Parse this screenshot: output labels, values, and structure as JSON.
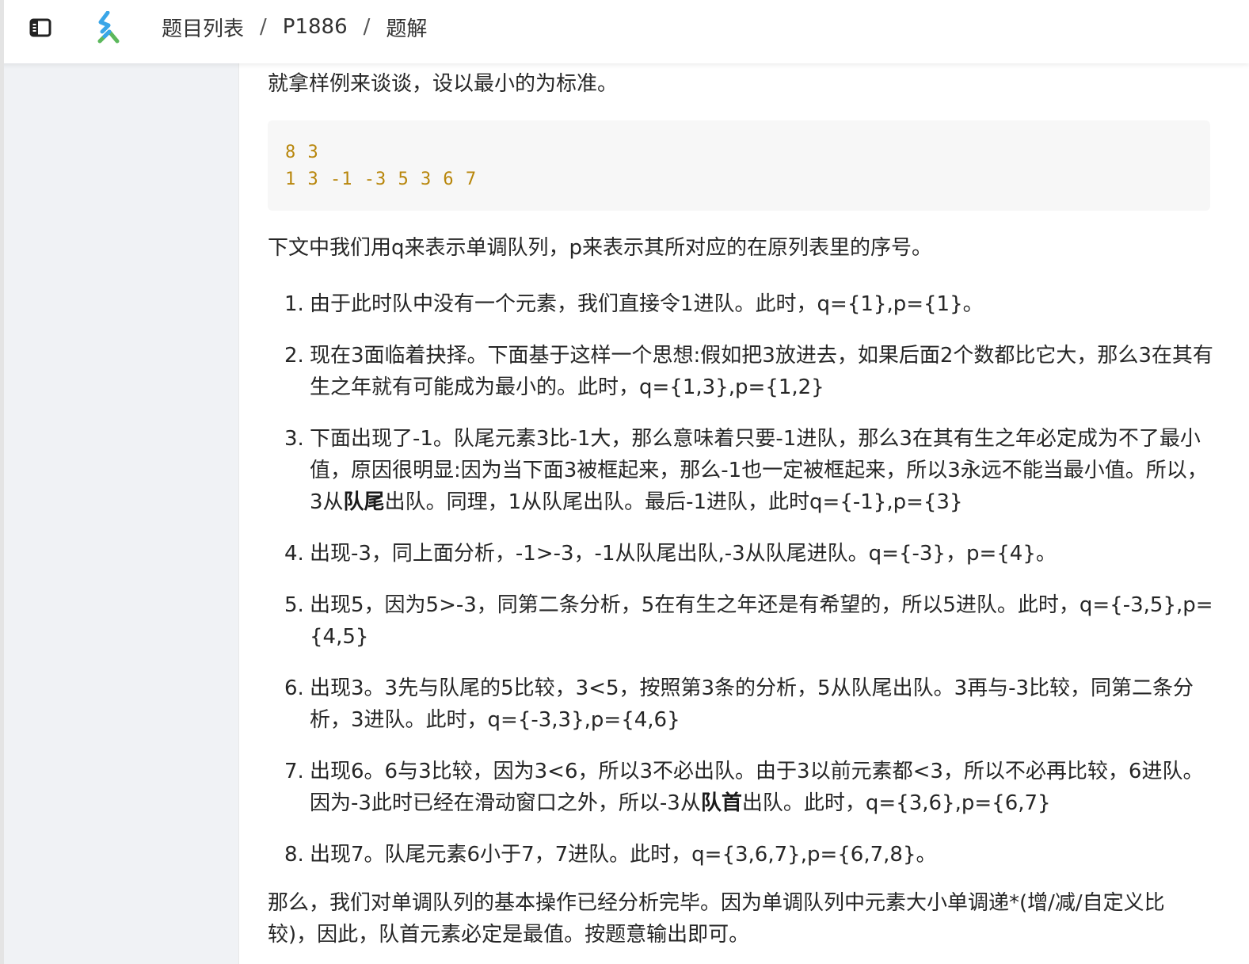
{
  "header": {
    "sidebar_toggle_icon": "sidebar-toggle-icon",
    "logo_icon": "app-logo-icon",
    "breadcrumb": [
      "题目列表",
      "P1886",
      "题解"
    ],
    "separator": "/"
  },
  "article": {
    "intro": "就拿样例来谈谈，设以最小的为标准。",
    "code_lines": [
      "8 3",
      "1 3 -1 -3 5 3 6 7"
    ],
    "explain": "下文中我们用q来表示单调队列，p来表示其所对应的在原列表里的序号。",
    "steps": [
      {
        "num": "1.",
        "parts": [
          "由于此时队中没有一个元素，我们直接令1进队。此时，q={1},p={1}。"
        ]
      },
      {
        "num": "2.",
        "parts": [
          "现在3面临着抉择。下面基于这样一个思想:假如把3放进去，如果后面2个数都比它大，那么3在其有生之年就有可能成为最小的。此时，q={1,3},p={1,2}"
        ]
      },
      {
        "num": "3.",
        "parts": [
          "下面出现了-1。队尾元素3比-1大，那么意味着只要-1进队，那么3在其有生之年必定成为不了最小值，原因很明显:因为当下面3被框起来，那么-1也一定被框起来，所以3永远不能当最小值。所以，3从",
          "队尾",
          "出队。同理，1从队尾出队。最后-1进队，此时q={-1},p={3}"
        ]
      },
      {
        "num": "4.",
        "parts": [
          "出现-3，同上面分析，-1>-3，-1从队尾出队,-3从队尾进队。q={-3}，p={4}。"
        ]
      },
      {
        "num": "5.",
        "parts": [
          "出现5，因为5>-3，同第二条分析，5在有生之年还是有希望的，所以5进队。此时，q={-3,5},p={4,5}"
        ]
      },
      {
        "num": "6.",
        "parts": [
          "出现3。3先与队尾的5比较，3<5，按照第3条的分析，5从队尾出队。3再与-3比较，同第二条分析，3进队。此时，q={-3,3},p={4,6}"
        ]
      },
      {
        "num": "7.",
        "parts": [
          "出现6。6与3比较，因为3<6，所以3不必出队。由于3以前元素都<3，所以不必再比较，6进队。因为-3此时已经在滑动窗口之外，所以-3从",
          "队首",
          "出队。此时，q={3,6},p={6,7}"
        ]
      },
      {
        "num": "8.",
        "parts": [
          "出现7。队尾元素6小于7，7进队。此时，q={3,6,7},p={6,7,8}。"
        ]
      }
    ],
    "conclusion": "那么，我们对单调队列的基本操作已经分析完毕。因为单调队列中元素大小单调递*(增/减/自定义比较)，因此，队首元素必定是最值。按题意输出即可。"
  },
  "colors": {
    "code_text": "#b8860b",
    "code_bg": "#f7f7f7",
    "sidebar_bg": "#f0f2f5",
    "logo_blue": "#3aa6e8",
    "logo_green": "#5cb85c"
  }
}
